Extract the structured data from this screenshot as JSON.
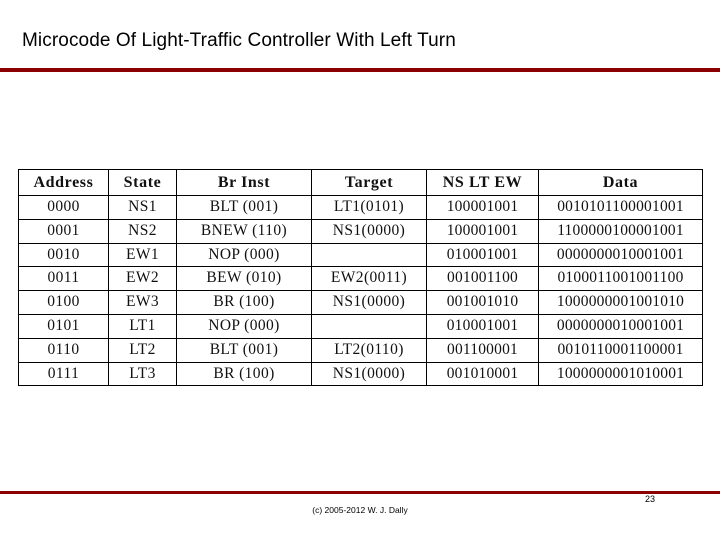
{
  "slide": {
    "title": "Microcode Of Light-Traffic Controller With Left Turn",
    "footer": "(c) 2005-2012 W. J. Dally",
    "page_number": "23",
    "accent_color": "#8B0000"
  },
  "table": {
    "headers": [
      "Address",
      "State",
      "Br Inst",
      "Target",
      "NS LT EW",
      "Data"
    ],
    "rows": [
      {
        "address": "0000",
        "state": "NS1",
        "br_inst": "BLT (001)",
        "target": "LT1(0101)",
        "ns_lt_ew": "100001001",
        "data": "0010101100001001"
      },
      {
        "address": "0001",
        "state": "NS2",
        "br_inst": "BNEW (110)",
        "target": "NS1(0000)",
        "ns_lt_ew": "100001001",
        "data": "1100000100001001"
      },
      {
        "address": "0010",
        "state": "EW1",
        "br_inst": "NOP (000)",
        "target": "",
        "ns_lt_ew": "010001001",
        "data": "0000000010001001"
      },
      {
        "address": "0011",
        "state": "EW2",
        "br_inst": "BEW (010)",
        "target": "EW2(0011)",
        "ns_lt_ew": "001001100",
        "data": "0100011001001100"
      },
      {
        "address": "0100",
        "state": "EW3",
        "br_inst": "BR (100)",
        "target": "NS1(0000)",
        "ns_lt_ew": "001001010",
        "data": "1000000001001010"
      },
      {
        "address": "0101",
        "state": "LT1",
        "br_inst": "NOP (000)",
        "target": "",
        "ns_lt_ew": "010001001",
        "data": "0000000010001001"
      },
      {
        "address": "0110",
        "state": "LT2",
        "br_inst": "BLT (001)",
        "target": "LT2(0110)",
        "ns_lt_ew": "001100001",
        "data": "0010110001100001"
      },
      {
        "address": "0111",
        "state": "LT3",
        "br_inst": "BR (100)",
        "target": "NS1(0000)",
        "ns_lt_ew": "001010001",
        "data": "1000000001010001"
      }
    ]
  }
}
